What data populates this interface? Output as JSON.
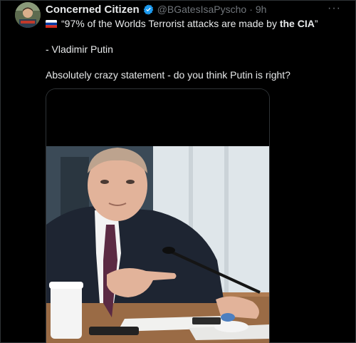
{
  "post": {
    "author": {
      "display_name": "Concerned Citizen",
      "handle": "@BGatesIsaPyscho",
      "separator": "·",
      "time": "9h",
      "verified": true
    },
    "more_label": "···",
    "text": {
      "flag_icon": "russia-flag-emoji",
      "quote_part1": "“97% of the Worlds Terrorist attacks are made by ",
      "quote_bold": "the CIA",
      "quote_end": "”",
      "attribution": "- Vladimir Putin",
      "comment": "Absolutely crazy statement - do you think Putin is right?"
    },
    "media": {
      "type": "photo",
      "alt_icon": "photo-of-man-speaking-at-desk"
    }
  },
  "colors": {
    "background": "#000000",
    "text_primary": "#e7e9ea",
    "text_secondary": "#71767b",
    "verified_blue": "#1d9bf0",
    "border": "#2f3336"
  }
}
